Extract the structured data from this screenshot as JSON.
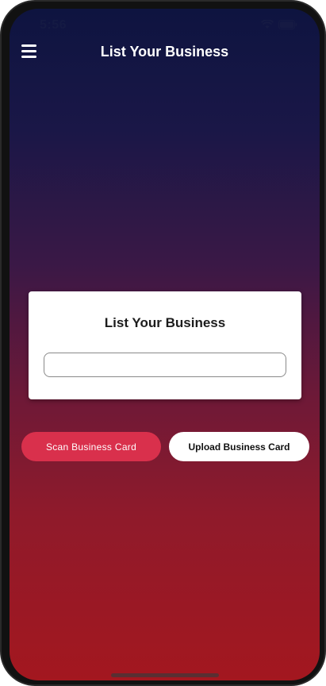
{
  "status_bar": {
    "time": "5:56"
  },
  "header": {
    "title": "List Your Business",
    "menu_icon": "hamburger-menu-icon"
  },
  "card": {
    "title": "List Your Business",
    "input_value": "",
    "input_placeholder": ""
  },
  "actions": {
    "scan_label": "Scan Business Card",
    "upload_label": "Upload Business Card"
  },
  "colors": {
    "background_top": "#0e1440",
    "background_bottom": "#a3171f",
    "scan_button": "#d9304c",
    "upload_button": "#ffffff"
  }
}
